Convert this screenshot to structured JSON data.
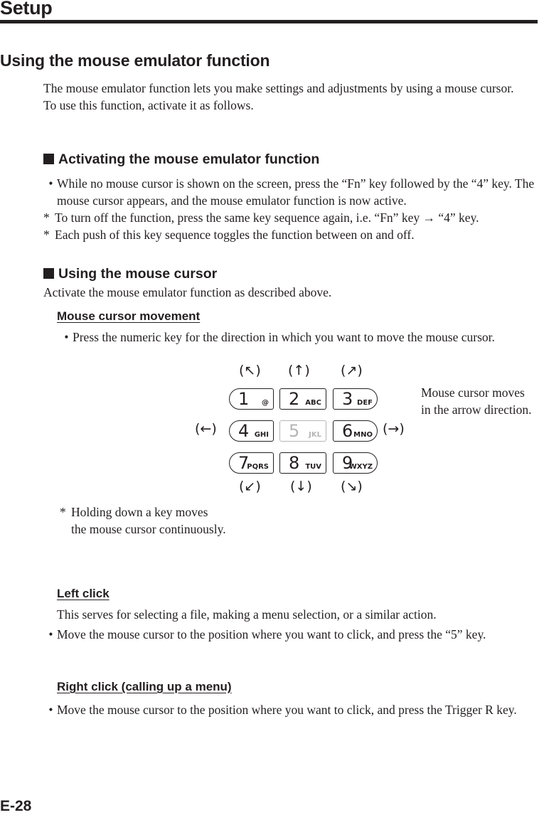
{
  "header": {
    "title": "Setup"
  },
  "section": {
    "title": "Using the mouse emulator function"
  },
  "intro": {
    "line1": "The mouse emulator function lets you make settings and adjustments by using a mouse cursor.",
    "line2": "To use this function, activate it as follows."
  },
  "activating": {
    "heading": "Activating the mouse emulator function",
    "bullet_mark": "•",
    "bullet": "While no mouse cursor is shown on the screen, press the “Fn” key followed by the “4” key. The mouse cursor appears, and the mouse emulator function is now active.",
    "note_mark": "*",
    "notes": [
      "To turn off the function, press the same key sequence again, i.e. “Fn” key → “4” key.",
      "Each push of this key sequence toggles the function between on and off."
    ]
  },
  "using": {
    "heading": "Using the mouse cursor",
    "intro": "Activate the mouse emulator function as described above.",
    "movement": {
      "heading": "Mouse cursor movement",
      "bullet_mark": "•",
      "bullet": "Press the numeric key for the direction in which you want to move the mouse cursor.",
      "arrows": {
        "up_left": "(↖)",
        "up": "(↑)",
        "up_right": "(↗)",
        "left": "(←)",
        "right": "(→)",
        "down_left": "(↙)",
        "down": "(↓)",
        "down_right": "(↘)"
      },
      "keys": [
        {
          "num": "1",
          "letters": "@"
        },
        {
          "num": "2",
          "letters": "ABC"
        },
        {
          "num": "3",
          "letters": "DEF"
        },
        {
          "num": "4",
          "letters": "GHI"
        },
        {
          "num": "5",
          "letters": "JKL"
        },
        {
          "num": "6",
          "letters": "MNO"
        },
        {
          "num": "7",
          "letters": "PQRS"
        },
        {
          "num": "8",
          "letters": "TUV"
        },
        {
          "num": "9",
          "letters": "WXYZ"
        }
      ],
      "side_note_line1": "Mouse cursor moves",
      "side_note_line2": "in the arrow direction.",
      "hold_mark": "*",
      "hold_line1": "Holding down a key moves",
      "hold_line2": "the mouse cursor continuously."
    },
    "left_click": {
      "heading": "Left click",
      "desc": "This serves for selecting a file, making a menu selection, or a similar action.",
      "bullet_mark": "•",
      "bullet": "Move the mouse cursor to the position where you want to click, and press the “5” key."
    },
    "right_click": {
      "heading": "Right click (calling up a menu)",
      "bullet_mark": "•",
      "bullet": "Move the mouse cursor to the position where you want to click, and press the Trigger R key."
    }
  },
  "footer": {
    "page_number": "E-28"
  }
}
